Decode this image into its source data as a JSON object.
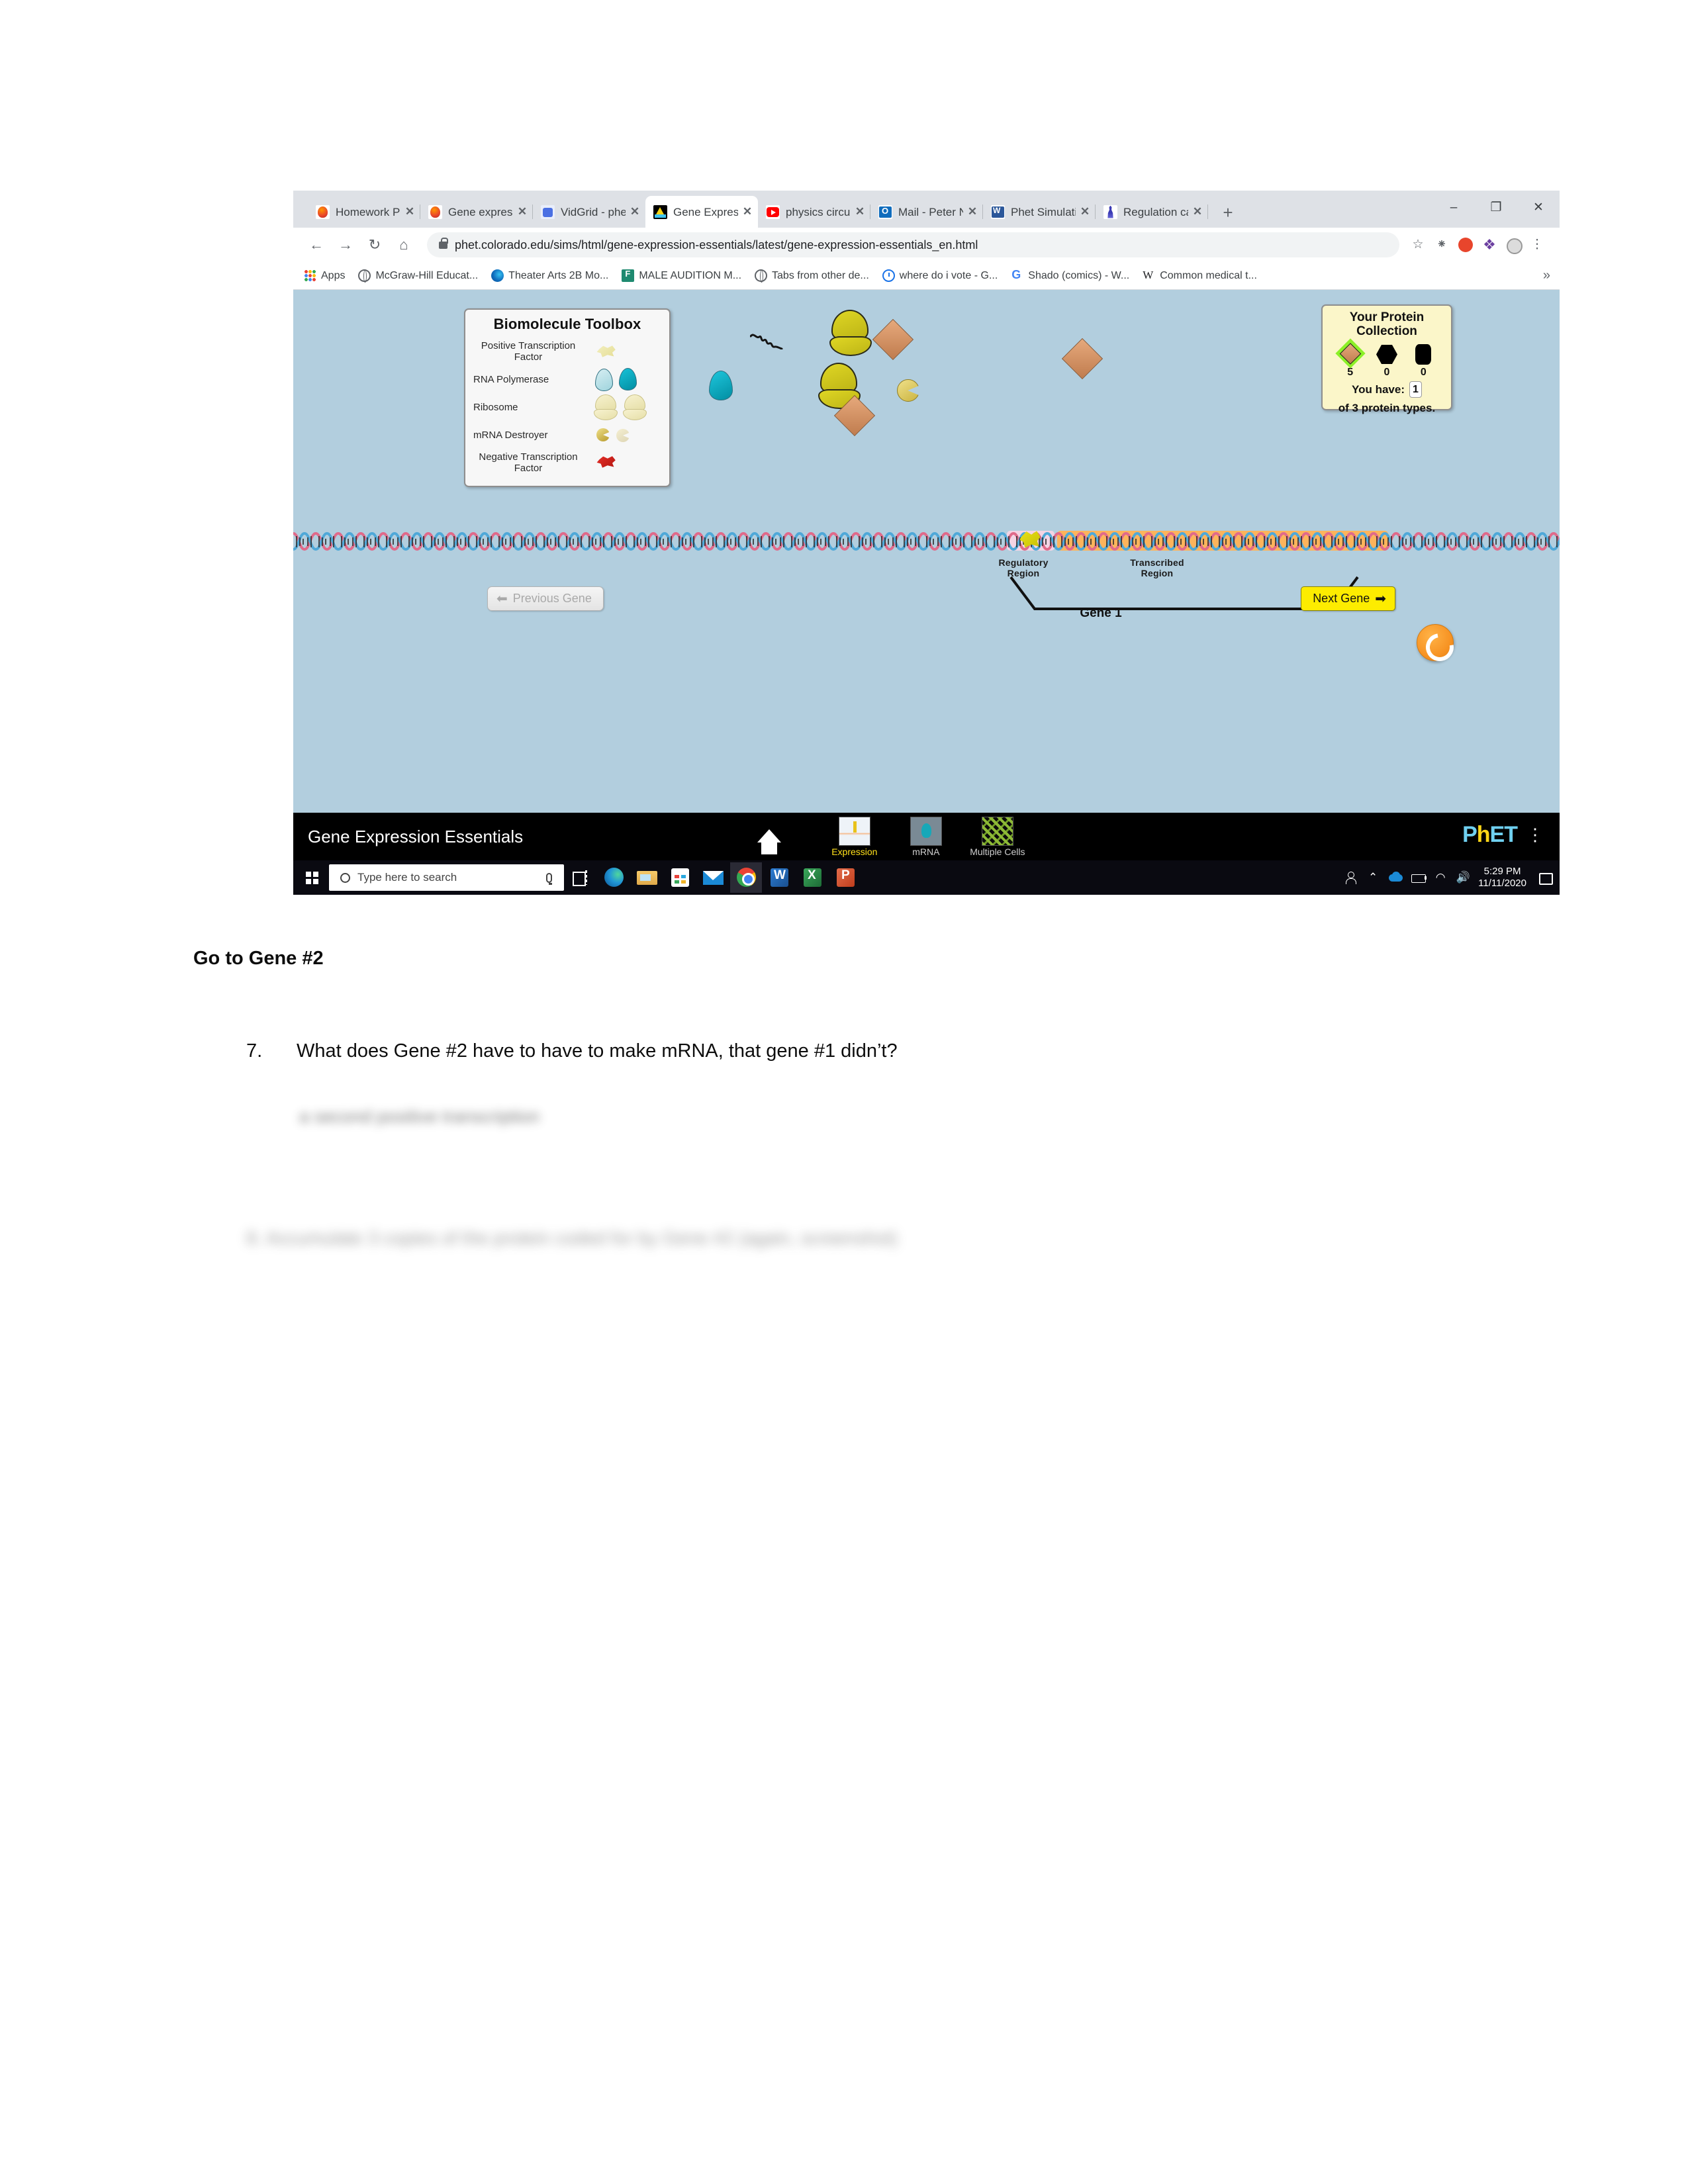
{
  "browser": {
    "tabs": [
      {
        "title": "Homework Pro",
        "favicon": "firefox-icon",
        "active": false
      },
      {
        "title": "Gene expressio",
        "favicon": "firefox-icon",
        "active": false
      },
      {
        "title": "VidGrid - phet",
        "favicon": "vidgrid-icon",
        "active": false
      },
      {
        "title": "Gene Expressio",
        "favicon": "phet-icon",
        "active": true
      },
      {
        "title": "physics circula",
        "favicon": "youtube-icon",
        "active": false
      },
      {
        "title": "Mail - Peter N",
        "favicon": "outlook-icon",
        "active": false
      },
      {
        "title": "Phet Simulatio",
        "favicon": "word-icon",
        "active": false
      },
      {
        "title": "Regulation ca",
        "favicon": "wikipedia-icon",
        "active": false
      }
    ],
    "tab_close_label": "✕",
    "new_tab_label": "+",
    "window_controls": {
      "minimize": "–",
      "maximize": "❐",
      "close": "✕"
    },
    "nav": {
      "back": "←",
      "forward": "→",
      "reload": "↻",
      "home": "⌂"
    },
    "url": "phet.colorado.edu/sims/html/gene-expression-essentials/latest/gene-expression-essentials_en.html",
    "omni_icons": [
      "star-icon",
      "extension-icon",
      "adblock-icon",
      "puzzle-icon",
      "profile-icon",
      "menu-icon"
    ],
    "bookmarks": [
      {
        "label": "Apps",
        "icon": "apps-grid-icon"
      },
      {
        "label": "McGraw-Hill Educat...",
        "icon": "globe-icon"
      },
      {
        "label": "Theater Arts 2B Mo...",
        "icon": "edge-icon"
      },
      {
        "label": "MALE AUDITION M...",
        "icon": "form-icon"
      },
      {
        "label": "Tabs from other de...",
        "icon": "globe-icon"
      },
      {
        "label": "where do i vote - G...",
        "icon": "clock-icon"
      },
      {
        "label": "Shado (comics) - W...",
        "icon": "google-icon"
      },
      {
        "label": "Common medical t...",
        "icon": "wikipedia-w-icon"
      }
    ],
    "bookmarks_overflow": "»"
  },
  "sim": {
    "toolbox": {
      "title": "Biomolecule Toolbox",
      "rows": [
        {
          "label": "Positive Transcription Factor",
          "art": "positive-transcription-factor"
        },
        {
          "label": "RNA Polymerase",
          "art": "rna-polymerase"
        },
        {
          "label": "Ribosome",
          "art": "ribosome"
        },
        {
          "label": "mRNA Destroyer",
          "art": "mrna-destroyer"
        },
        {
          "label": "Negative Transcription Factor",
          "art": "negative-transcription-factor"
        }
      ]
    },
    "protein_collection": {
      "title_line1": "Your Protein",
      "title_line2": "Collection",
      "proteins": [
        {
          "shape": "diamond",
          "count": "5",
          "collected": true
        },
        {
          "shape": "hexagon",
          "count": "0",
          "collected": false
        },
        {
          "shape": "cylinder",
          "count": "0",
          "collected": false
        }
      ],
      "you_have_label": "You have:",
      "you_have_value": "1",
      "of_types_label": "of 3 protein types."
    },
    "dna": {
      "regulatory_label_line1": "Regulatory",
      "regulatory_label_line2": "Region",
      "transcribed_label_line1": "Transcribed",
      "transcribed_label_line2": "Region",
      "gene_label": "Gene 1"
    },
    "buttons": {
      "previous_gene": "Previous Gene",
      "previous_gene_arrow": "⬅",
      "previous_gene_disabled": true,
      "next_gene": "Next Gene",
      "next_gene_arrow": "➡",
      "reset_all": "reset-all-icon"
    },
    "footer": {
      "sim_title": "Gene Expression Essentials",
      "home_icon": "home-icon",
      "screens": [
        {
          "label": "Expression",
          "selected": true
        },
        {
          "label": "mRNA",
          "selected": false
        },
        {
          "label": "Multiple Cells",
          "selected": false
        }
      ],
      "logo_part1": "P",
      "logo_part2": "h",
      "logo_part3": "ET",
      "menu_dots": "⋮"
    },
    "colors": {
      "stage_background": "#b2cede",
      "toolbox_background": "#f7f7f7",
      "protein_panel_background": "#fbf6c9",
      "next_gene_button": "#fdec00",
      "highlight_green": "#8cf028",
      "transcribed_region": "#fcb45c",
      "regulatory_region": "#f3d4e4",
      "reset_button": "#f79323"
    }
  },
  "taskbar": {
    "start_icon": "windows-start-icon",
    "search_placeholder": "Type here to search",
    "search_icon": "search-circle-icon",
    "mic_icon": "microphone-icon",
    "apps": [
      {
        "name": "task-view-icon"
      },
      {
        "name": "edge-icon"
      },
      {
        "name": "file-explorer-icon"
      },
      {
        "name": "microsoft-store-icon"
      },
      {
        "name": "mail-icon"
      },
      {
        "name": "chrome-icon",
        "active": true
      },
      {
        "name": "word-icon"
      },
      {
        "name": "excel-icon"
      },
      {
        "name": "powerpoint-icon"
      }
    ],
    "tray": [
      {
        "name": "people-icon"
      },
      {
        "name": "show-hidden-icons-chevron"
      },
      {
        "name": "onedrive-icon"
      },
      {
        "name": "battery-icon"
      },
      {
        "name": "wifi-icon"
      },
      {
        "name": "volume-icon"
      }
    ],
    "chevron": "⌃",
    "wifi": "◠",
    "volume": "🔊",
    "time": "5:29 PM",
    "date": "11/11/2020",
    "action_center_icon": "action-center-icon"
  },
  "document": {
    "heading": "Go to Gene #2",
    "question_number": "7.",
    "question_text": "What does Gene #2 have to have to make mRNA, that gene #1 didn’t?",
    "answer_blurred": "a second positive transcription",
    "next_item_blurred": "8.  Accumulate 3 copies of the protein coded for by Gene #2 (again, screenshot)"
  }
}
